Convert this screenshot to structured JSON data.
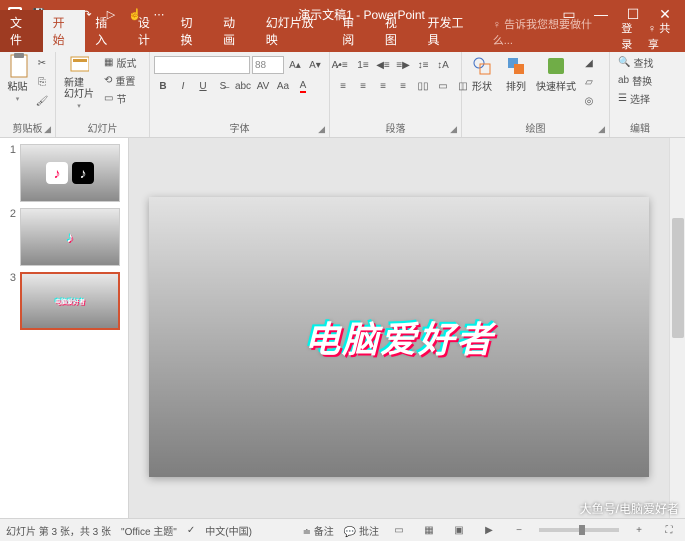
{
  "title": "演示文稿1 - PowerPoint",
  "qat": {
    "save": "💾",
    "undo": "↶",
    "redo": "↷",
    "start": "▷"
  },
  "win": {
    "ribbon_opts": "▭",
    "min": "—",
    "max": "☐",
    "close": "✕"
  },
  "tabs": {
    "file": "文件",
    "home": "开始",
    "insert": "插入",
    "design": "设计",
    "transitions": "切换",
    "animations": "动画",
    "slideshow": "幻灯片放映",
    "review": "审阅",
    "view": "视图",
    "developer": "开发工具",
    "tellme": "告诉我您想要做什么...",
    "login": "登录",
    "share": "共享"
  },
  "ribbon": {
    "clipboard": {
      "label": "剪贴板",
      "paste": "粘贴",
      "cut": "剪切",
      "copy": "复制",
      "painter": "格式刷"
    },
    "slides": {
      "label": "幻灯片",
      "new": "新建\n幻灯片",
      "layout": "版式",
      "reset": "重置",
      "section": "节"
    },
    "font": {
      "label": "字体",
      "size": "88"
    },
    "paragraph": {
      "label": "段落"
    },
    "drawing": {
      "label": "绘图",
      "shapes": "形状",
      "arrange": "排列",
      "quickstyles": "快速样式"
    },
    "editing": {
      "label": "编辑",
      "find": "查找",
      "replace": "替换",
      "select": "选择"
    }
  },
  "thumbs": [
    {
      "num": "1"
    },
    {
      "num": "2"
    },
    {
      "num": "3"
    }
  ],
  "slide_text": "电脑爱好者",
  "status": {
    "slide_info": "幻灯片 第 3 张，共 3 张",
    "theme": "\"Office 主题\"",
    "lang": "中文(中国)",
    "notes": "备注",
    "comments": "批注"
  },
  "watermark": "大鱼号/电脑爱好者"
}
